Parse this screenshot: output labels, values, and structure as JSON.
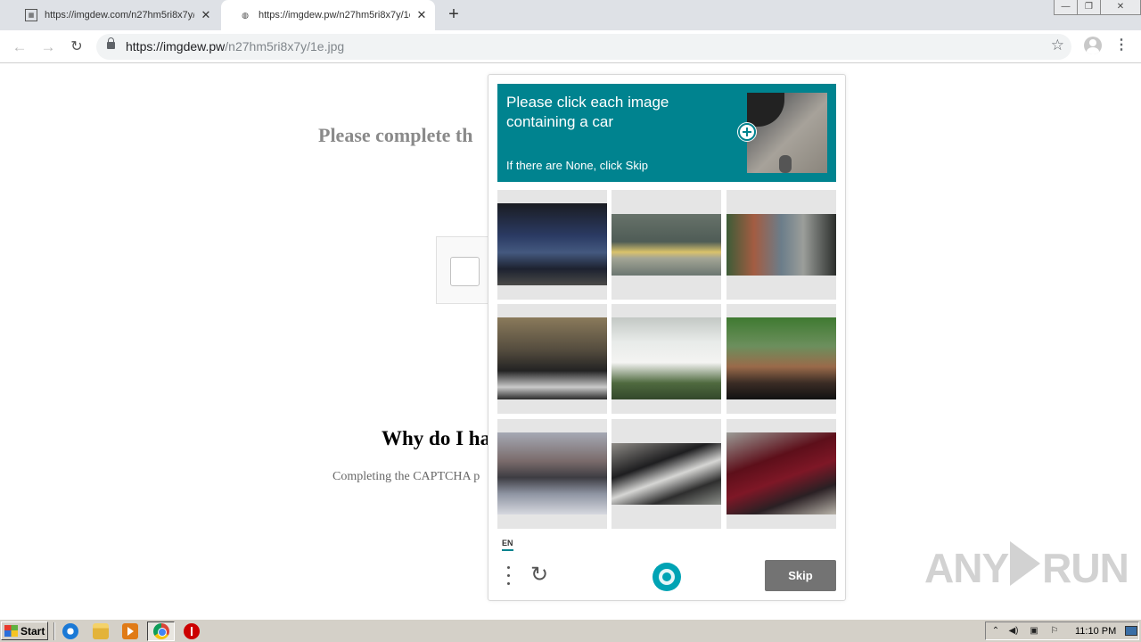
{
  "browser": {
    "tabs": [
      {
        "title": "https://imgdew.com/n27hm5ri8x7y/1",
        "active": false
      },
      {
        "title": "https://imgdew.pw/n27hm5ri8x7y/1e",
        "active": true
      }
    ],
    "new_tab": "+",
    "window_controls": {
      "minimize": "—",
      "restore": "❐",
      "close": "✕"
    },
    "nav": {
      "back": "←",
      "forward": "→",
      "reload": "↻"
    },
    "url": {
      "host": "https://imgdew.pw",
      "path": "/n27hm5ri8x7y/1e.jpg"
    },
    "bookmark": "☆",
    "menu": "⋮"
  },
  "page": {
    "heading": "Please complete th",
    "why_heading": "Why do I ha",
    "why_text": "Completing the CAPTCHA p"
  },
  "captcha": {
    "prompt": "Please click each image containing a car",
    "subprompt": "If there are None, click Skip",
    "tiles": [
      {
        "subject": "blue car in parking garage"
      },
      {
        "subject": "kayaker on water"
      },
      {
        "subject": "cyclists on street"
      },
      {
        "subject": "motorcycle dashboard view"
      },
      {
        "subject": "white car on grass"
      },
      {
        "subject": "bicycle handlebar view"
      },
      {
        "subject": "ship on water"
      },
      {
        "subject": "black car wheel"
      },
      {
        "subject": "dark red car fender"
      }
    ],
    "language": "EN",
    "skip_label": "Skip",
    "accent_color": "#00838f"
  },
  "watermark": {
    "left": "ANY",
    "right": "RUN"
  },
  "taskbar": {
    "start_label": "Start",
    "clock": "11:10 PM"
  }
}
